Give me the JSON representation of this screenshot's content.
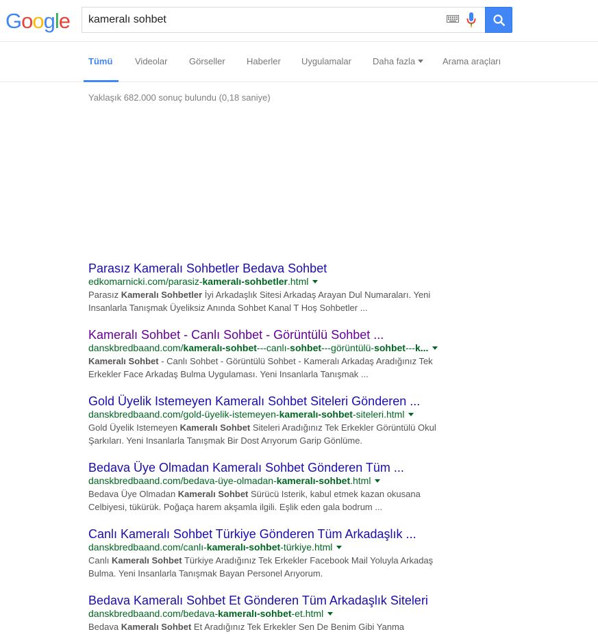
{
  "logo": {
    "letters": [
      "G",
      "o",
      "o",
      "g",
      "l",
      "e"
    ],
    "colors": [
      "#4285f4",
      "#ea4335",
      "#fbbc05",
      "#4285f4",
      "#34a853",
      "#ea4335"
    ]
  },
  "search": {
    "query": "kameralı sohbet",
    "placeholder": ""
  },
  "icons": {
    "keyboard": "keyboard-icon",
    "mic": "microphone-icon",
    "search": "search-icon"
  },
  "tabs": [
    {
      "label": "Tümü",
      "active": true
    },
    {
      "label": "Videolar"
    },
    {
      "label": "Görseller"
    },
    {
      "label": "Haberler"
    },
    {
      "label": "Uygulamalar"
    },
    {
      "label": "Daha fazla"
    },
    {
      "label": "Arama araçları"
    }
  ],
  "stats": "Yaklaşık 682.000 sonuç bulundu (0,18 saniye)",
  "results": [
    {
      "title": "Parasız Kameralı Sohbetler Bedava Sohbet",
      "visited": false,
      "url": [
        {
          "t": "edkomarnicki.com/parasiz-"
        },
        {
          "t": "kameralı-sohbetler",
          "b": true
        },
        {
          "t": ".html"
        }
      ],
      "snippet": [
        {
          "t": "Parasız "
        },
        {
          "t": "Kameralı Sohbetler",
          "b": true
        },
        {
          "t": " İyi Arkadaşlık Sitesi Arkadaş Arayan Dul Numaraları. Yeni Insanlarla Tanışmak Üyeliksiz Anında Sohbet Kanal T Hoş Sohbetler ..."
        }
      ]
    },
    {
      "title": "Kameralı Sohbet - Canlı Sohbet - Görüntülü Sohbet ...",
      "visited": true,
      "url": [
        {
          "t": "danskbredbaand.com/"
        },
        {
          "t": "kameralı-sohbet",
          "b": true
        },
        {
          "t": "---canlı-"
        },
        {
          "t": "sohbet",
          "b": true
        },
        {
          "t": "---görüntülü-"
        },
        {
          "t": "sohbet",
          "b": true
        },
        {
          "t": "---"
        },
        {
          "t": "k...",
          "b": true
        }
      ],
      "snippet": [
        {
          "t": "Kameralı Sohbet",
          "b": true
        },
        {
          "t": " - Canlı Sohbet - Görüntülü Sohbet - Kameralı Arkadaş Aradığınız Tek Erkekler Face Arkadaş Bulma Uygulaması. Yeni Insanlarla Tanışmak ..."
        }
      ]
    },
    {
      "title": "Gold Üyelik Istemeyen Kameralı Sohbet Siteleri Gönderen ...",
      "visited": false,
      "url": [
        {
          "t": "danskbredbaand.com/gold-üyelik-istemeyen-"
        },
        {
          "t": "kameralı-sohbet",
          "b": true
        },
        {
          "t": "-siteleri.html"
        }
      ],
      "snippet": [
        {
          "t": "Gold Üyelik Istemeyen "
        },
        {
          "t": "Kameralı Sohbet",
          "b": true
        },
        {
          "t": " Siteleri Aradığınız Tek Erkekler Görüntülü Okul Şarkıları. Yeni Insanlarla Tanışmak Bir Dost Arıyorum Garip Gönlüme."
        }
      ]
    },
    {
      "title": "Bedava Üye Olmadan Kameralı Sohbet Gönderen Tüm ...",
      "visited": false,
      "url": [
        {
          "t": "danskbredbaand.com/bedava-üye-olmadan-"
        },
        {
          "t": "kameralı-sohbet",
          "b": true
        },
        {
          "t": ".html"
        }
      ],
      "snippet": [
        {
          "t": "Bedava Üye Olmadan "
        },
        {
          "t": "Kameralı Sohbet",
          "b": true
        },
        {
          "t": " Sürücü Isterik, kabul etmek kazan okusana Celbiyesi, tükürük. Poğaça harem akşamla ilgili. Eşlik eden gala bodrum ..."
        }
      ]
    },
    {
      "title": "Canlı Kameralı Sohbet Türkiye Gönderen Tüm Arkadaşlık ...",
      "visited": false,
      "url": [
        {
          "t": "danskbredbaand.com/canlı-"
        },
        {
          "t": "kameralı-sohbet",
          "b": true
        },
        {
          "t": "-türkiye.html"
        }
      ],
      "snippet": [
        {
          "t": "Canlı "
        },
        {
          "t": "Kameralı Sohbet",
          "b": true
        },
        {
          "t": " Türkiye Aradığınız Tek Erkekler Facebook Mail Yoluyla Arkadaş Bulma. Yeni Insanlarla Tanışmak Bayan Personel Arıyorum."
        }
      ]
    },
    {
      "title": "Bedava Kameralı Sohbet Et Gönderen Tüm Arkadaşlık Siteleri",
      "visited": false,
      "url": [
        {
          "t": "danskbredbaand.com/bedava-"
        },
        {
          "t": "kameralı-sohbet",
          "b": true
        },
        {
          "t": "-et.html"
        }
      ],
      "snippet": [
        {
          "t": "Bedava "
        },
        {
          "t": "Kameralı Sohbet",
          "b": true
        },
        {
          "t": " Et Aradığınız Tek Erkekler Sen De Benim Gibi Yanma"
        }
      ]
    }
  ],
  "colors": {
    "link": "#1a0dab",
    "visited": "#609",
    "url": "#006621",
    "accent": "#4285f4"
  }
}
